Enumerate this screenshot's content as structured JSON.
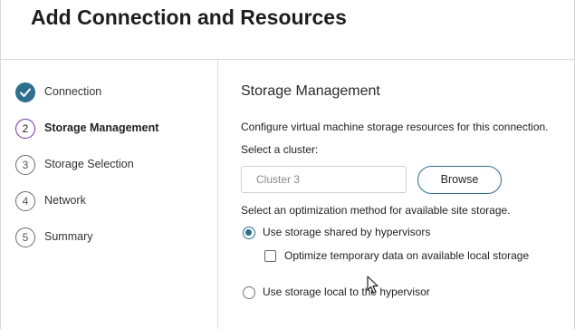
{
  "header": {
    "title": "Add Connection and Resources"
  },
  "steps": [
    {
      "number": "",
      "label": "Connection",
      "state": "done"
    },
    {
      "number": "2",
      "label": "Storage Management",
      "state": "active"
    },
    {
      "number": "3",
      "label": "Storage Selection",
      "state": "pending"
    },
    {
      "number": "4",
      "label": "Network",
      "state": "pending"
    },
    {
      "number": "5",
      "label": "Summary",
      "state": "pending"
    }
  ],
  "main": {
    "heading": "Storage Management",
    "description": "Configure virtual machine storage resources for this connection.",
    "cluster_label": "Select a cluster:",
    "cluster_placeholder": "Cluster 3",
    "browse_label": "Browse",
    "optimization_label": "Select an optimization method for available site storage.",
    "options": {
      "shared": {
        "label": "Use storage shared by hypervisors",
        "selected": true
      },
      "optimize_temp": {
        "label": "Optimize temporary data on available local storage",
        "checked": false
      },
      "local": {
        "label": "Use storage local to the hypervisor",
        "selected": false
      }
    }
  },
  "colors": {
    "accent": "#2d6f8d",
    "active_step": "#6b2fa0"
  }
}
